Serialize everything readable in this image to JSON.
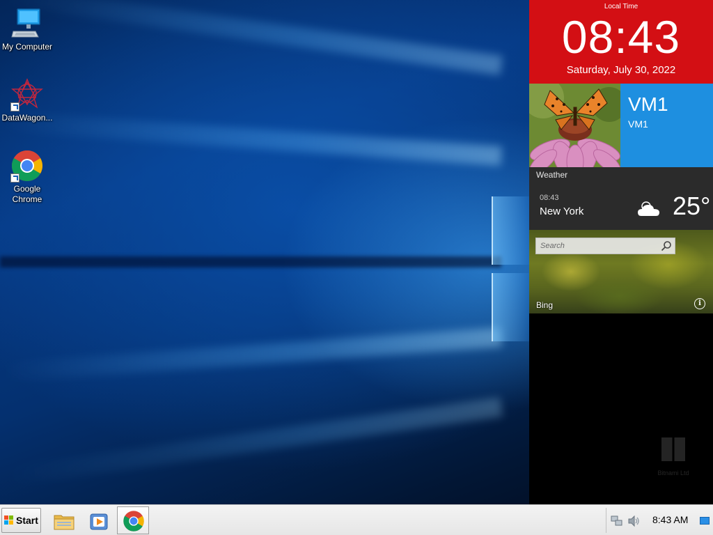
{
  "desktop": {
    "icons": [
      {
        "label": "My Computer",
        "icon": "computer-icon"
      },
      {
        "label": "DataWagon...",
        "icon": "datawagon-icon"
      },
      {
        "label": "Google Chrome",
        "icon": "chrome-icon"
      }
    ]
  },
  "side_panel": {
    "clock": {
      "title": "Local Time",
      "time": "08:43",
      "date": "Saturday, July 30, 2022",
      "color": "#d30f14"
    },
    "vm_tile": {
      "title": "VM1",
      "subtitle": "VM1",
      "color": "#1e8fe0"
    },
    "photo_tile": {
      "icon": "butterfly-photo-icon"
    },
    "weather": {
      "title": "Weather",
      "time": "08:43",
      "city": "New York",
      "temperature": "25°",
      "icon": "cloudy-icon"
    },
    "bing": {
      "search_placeholder": "Search",
      "label": "Bing",
      "search_icon": "search-icon",
      "info_icon": "info-icon",
      "info_glyph": "i"
    },
    "watermark": {
      "text": "Bitnami Ltd"
    }
  },
  "taskbar": {
    "start_label": "Start",
    "apps": [
      {
        "name": "File Explorer",
        "icon": "folder-icon"
      },
      {
        "name": "Media Player",
        "icon": "media-player-icon"
      },
      {
        "name": "Google Chrome",
        "icon": "chrome-icon",
        "active": true
      }
    ],
    "tray": {
      "time": "8:43 AM",
      "network_icon": "network-icon",
      "volume_icon": "volume-icon",
      "show_desktop_icon": "show-desktop-icon"
    }
  }
}
